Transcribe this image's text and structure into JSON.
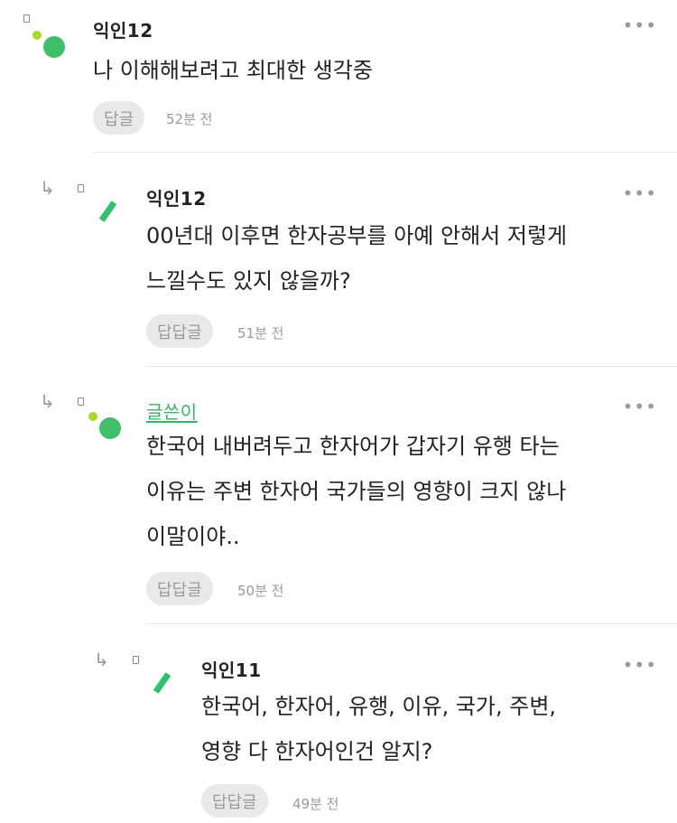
{
  "comments": [
    {
      "author": "익인12",
      "more": "•••",
      "lines": [
        "나 이해해보려고 최대한 생각중"
      ],
      "reply_label": "답글",
      "time": "52분 전"
    },
    {
      "author": "익인12",
      "more": "•••",
      "lines": [
        "00년대 이후면 한자공부를 아예 안해서 저렇게",
        "느낄수도 있지 않을까?"
      ],
      "reply_label": "답답글",
      "time": "51분 전"
    },
    {
      "author": "글쓴이",
      "more": "•••",
      "lines": [
        "한국어 내버려두고 한자어가 갑자기 유행 타는",
        "이유는 주변 한자어 국가들의 영향이 크지 않나",
        "이말이야.."
      ],
      "reply_label": "답답글",
      "time": "50분 전"
    },
    {
      "author": "익인11",
      "more": "•••",
      "lines": [
        "한국어, 한자어, 유행, 이유, 국가, 주변,",
        "영향 다 한자어인건 알지?"
      ],
      "reply_label": "답답글",
      "time": "49분 전"
    }
  ],
  "icons": {
    "reply_arrow": "↳",
    "colors": {
      "accent_green": "#3fbf6a",
      "light_green": "#a6da2a",
      "op_name": "#3bb266"
    }
  }
}
